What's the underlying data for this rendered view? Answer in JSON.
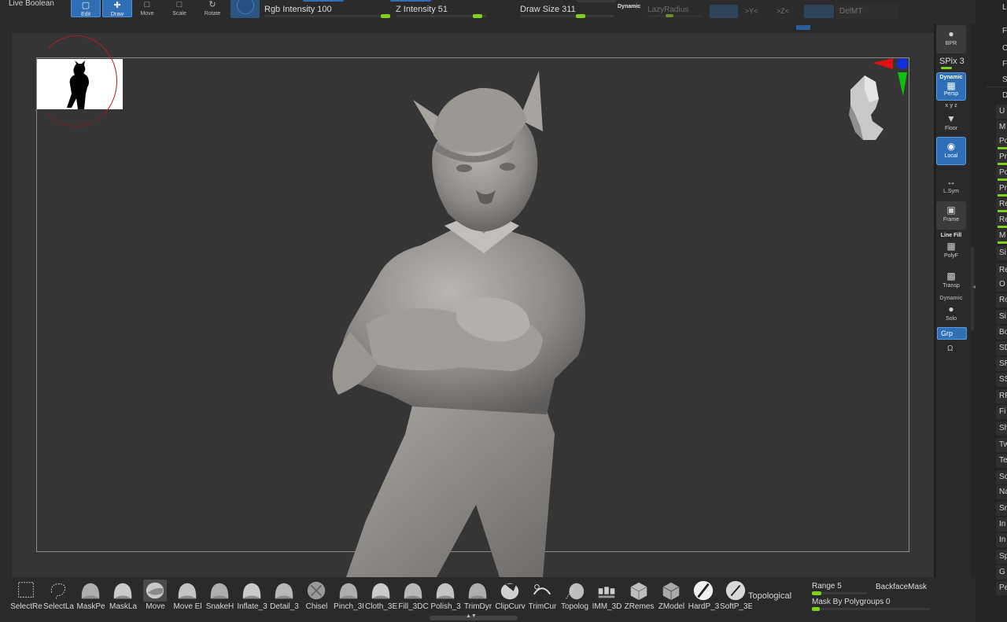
{
  "toolbar": {
    "live_boolean": "Live Boolean",
    "edit_label": "Edit",
    "draw_label": "Draw",
    "move_label": "Move",
    "scale_label": "Scale",
    "rotate_label": "Rotate",
    "rgb_intensity": "Rgb Intensity 100",
    "rgb_intensity_value": 100,
    "z_intensity": "Z Intensity 51",
    "z_intensity_value": 51,
    "draw_size": "Draw Size 311",
    "draw_size_value": 311,
    "dynamic": "Dynamic",
    "lazy_radius": "LazyRadius",
    "x_axis": ">Y<",
    "z_axis": ">Z<",
    "delmt": "DelMT"
  },
  "right_shelf": {
    "bpr": "BPR",
    "spix": "SPix 3",
    "dynamic": "Dynamic",
    "persp": "Persp",
    "xyz": "x y z",
    "floor": "Floor",
    "local": "Local",
    "lsym": "L.Sym",
    "frame": "Frame",
    "line_fill": "Line Fill",
    "polyf": "PolyF",
    "transp": "Transp",
    "dynamic2": "Dynamic",
    "solo": "Solo",
    "grp": "Grp"
  },
  "far_right_items": [
    "L",
    "F",
    "C",
    "F",
    "S",
    "D",
    "U",
    "M",
    "Po",
    "Pr",
    "Po",
    "Pr",
    "Re",
    "Re",
    "M",
    "Si",
    "Re",
    "O",
    "Ro",
    "Si",
    "Bo",
    "SD",
    "SR",
    "SS",
    "RF",
    "Fi",
    "Sh",
    "Tw",
    "Te",
    "Sc",
    "Na",
    "Sn",
    "In",
    "In",
    "Sp",
    "G",
    "Pe"
  ],
  "brushes": [
    {
      "label": "SelectRe",
      "icon": "select-rect-icon"
    },
    {
      "label": "SelectLa",
      "icon": "select-lasso-icon"
    },
    {
      "label": "MaskPe",
      "icon": "mask-pen-icon"
    },
    {
      "label": "MaskLa",
      "icon": "mask-lasso-icon"
    },
    {
      "label": "Move",
      "icon": "move-brush-icon"
    },
    {
      "label": "Move El",
      "icon": "move-elastic-icon"
    },
    {
      "label": "SnakeH",
      "icon": "snake-hook-icon"
    },
    {
      "label": "Inflate_3",
      "icon": "inflate-icon"
    },
    {
      "label": "Detail_3",
      "icon": "detail-icon"
    },
    {
      "label": "Chisel",
      "icon": "chisel-icon"
    },
    {
      "label": "Pinch_3I",
      "icon": "pinch-icon"
    },
    {
      "label": "Cloth_3E",
      "icon": "cloth-icon"
    },
    {
      "label": "Fill_3DC",
      "icon": "fill-icon"
    },
    {
      "label": "Polish_3",
      "icon": "polish-icon"
    },
    {
      "label": "TrimDyr",
      "icon": "trim-dynamic-icon"
    },
    {
      "label": "ClipCurv",
      "icon": "clip-curve-icon"
    },
    {
      "label": "TrimCur",
      "icon": "trim-curve-icon"
    },
    {
      "label": "Topolog",
      "icon": "topology-icon"
    },
    {
      "label": "IMM_3D",
      "icon": "imm-icon"
    },
    {
      "label": "ZRemes",
      "icon": "zremesher-icon"
    },
    {
      "label": "ZModel",
      "icon": "zmodeler-icon"
    },
    {
      "label": "HardP_3",
      "icon": "hardpolish-icon"
    },
    {
      "label": "SoftP_3E",
      "icon": "softpolish-icon"
    }
  ],
  "bottom": {
    "topological": "Topological",
    "range": "Range 5",
    "range_value": 5,
    "backface_mask": "BackfaceMask",
    "mask_by_polygroups": "Mask By Polygroups 0",
    "mask_by_polygroups_value": 0
  },
  "colors": {
    "accent_blue": "#2e6fb6",
    "slider_green": "#7fd11e",
    "viewport_bg": "#353535",
    "gyro_red": "#e01010",
    "gyro_green": "#10c010",
    "gyro_blue": "#1030e0"
  }
}
